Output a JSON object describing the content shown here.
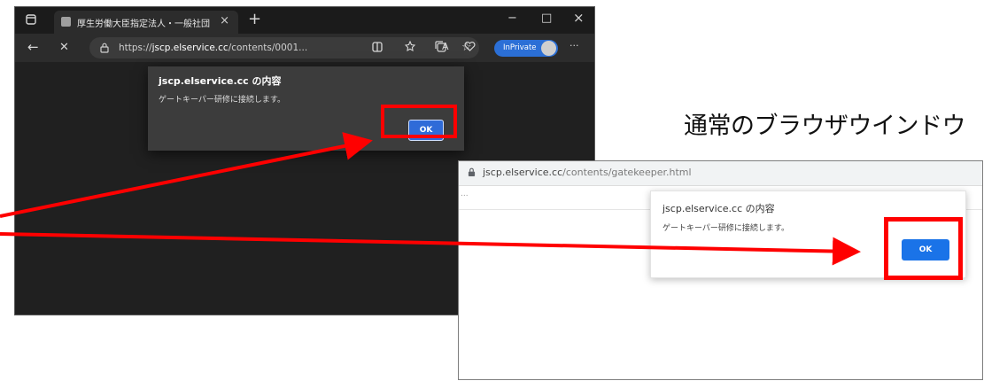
{
  "dark_browser": {
    "tab_title": "厚生労働大臣指定法人・一般社団",
    "tab_close": "×",
    "new_tab": "+",
    "window_controls": {
      "minimize": "−",
      "maximize": "□",
      "close": "×"
    },
    "address": {
      "scheme": "https://",
      "host": "jscp.elservice.cc",
      "path": "/contents/0001..."
    },
    "inprivate_label": "InPrivate",
    "dialog": {
      "title": "jscp.elservice.cc の内容",
      "message": "ゲートキーパー研修に接続します。",
      "ok_label": "OK"
    }
  },
  "caption": "通常のブラウザウインドウ",
  "light_browser": {
    "address": {
      "host": "jscp.elservice.cc",
      "path": "/contents/gatekeeper.html"
    },
    "ellipsis": "...",
    "dialog": {
      "title": "jscp.elservice.cc の内容",
      "message": "ゲートキーパー研修に接続します。",
      "ok_label": "OK"
    }
  },
  "icons": {
    "back": "←",
    "stop": "✕",
    "more": "···",
    "star": "☆",
    "read_aloud": "A",
    "lock": "🔒"
  },
  "colors": {
    "highlight": "#ff0000",
    "inprivate_blue": "#2b6fd6",
    "ok_blue": "#1a73e8"
  }
}
